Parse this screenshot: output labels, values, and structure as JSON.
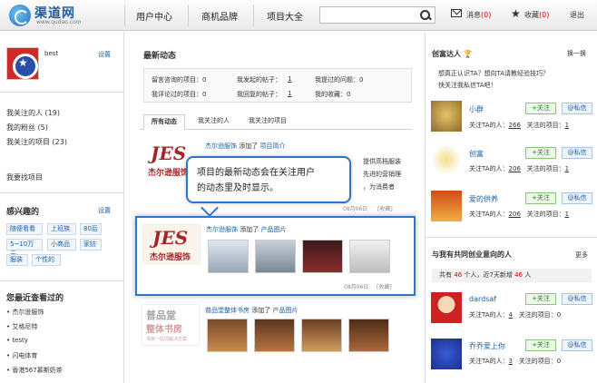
{
  "header": {
    "logo_text": "渠道网",
    "logo_sub": "www.qudao.com",
    "nav": [
      "用户中心",
      "商机品牌",
      "项目大全"
    ],
    "search_placeholder": "",
    "messages_label": "消息",
    "messages_count": "(0)",
    "favorites_label": "收藏",
    "favorites_count": "(0)",
    "logout": "退出"
  },
  "left": {
    "username": "best",
    "settings": "设置",
    "stats": [
      "我关注的人 (19)",
      "我的粉丝 (5)",
      "我关注的项目 (23)"
    ],
    "find_project": "我要找项目",
    "interest_title": "感兴趣的",
    "interest_settings": "设置",
    "interest_tags": [
      "随便看看",
      "上班族",
      "80后",
      "5~10万元",
      "小商品",
      "家纺",
      "服装",
      "个性的"
    ],
    "recent_title": "您最近查看过的",
    "recent_items": [
      "• 杰尔逊服饰",
      "• 艾格尼特",
      "• testy",
      "• 闪电体育",
      "• 香港567慕斯奶茶"
    ]
  },
  "main": {
    "title": "最新动态",
    "stats_box": {
      "row1": [
        "留言咨询的项目：0",
        "我发起的帖子：",
        "1",
        "我提过的问题：0"
      ],
      "row2": [
        "我评论过的项目：0",
        "我回复的帖子：",
        "1",
        "我的收藏：0"
      ]
    },
    "tabs": [
      "所有动态",
      "我关注的人",
      "我关注的项目"
    ],
    "feed": [
      {
        "company": "杰尔逊服饰",
        "action": "添加了",
        "target": "项目简介",
        "snippet1": "提供高档服装",
        "snippet2": "先进的营销理",
        "snippet3": "，为消费者"
      },
      {
        "company": "杰尔逊服饰",
        "action": "添加了",
        "target": "产品图片",
        "date": "08月06日",
        "fav": "[收藏]"
      },
      {
        "company": "普品堂整体书房",
        "action": "添加了",
        "target": "产品图片",
        "date": "08月06日",
        "fav": "[收藏]"
      }
    ],
    "first_date": "08月06日",
    "first_fav": "[收藏]",
    "brand_logo_text": "杰尔逊服饰",
    "brand_logo_mark": "JES",
    "shop_logo_text": "普品堂",
    "shop_logo_sub": "整体书房",
    "shop_logo_tag": "书房一站式解决方案",
    "tooltip_line1": "项目的最新动态会在关注用户",
    "tooltip_line2": "的动态里及时显示。"
  },
  "right": {
    "section1_title": "创富达人",
    "section1_more": "换一换",
    "desc1": "想真正认识TA？想向TA请教经验技巧？",
    "desc2": "快关注我私信TA吧！",
    "people": [
      {
        "name": "小群",
        "fans_label": "关注TA的人：",
        "fans": "266",
        "proj_label": "关注的项目：",
        "proj": "1"
      },
      {
        "name": "创富",
        "fans_label": "关注TA的人：",
        "fans": "206",
        "proj_label": "关注的项目：",
        "proj": "1"
      },
      {
        "name": "爱的供养",
        "fans_label": "关注TA的人：",
        "fans": "206",
        "proj_label": "关注的项目：",
        "proj": "1"
      }
    ],
    "follow": "+关注",
    "message": "@私信",
    "section2_title": "与我有共同创业意向的人",
    "section2_more": "更多",
    "common_bar_prefix": "共有",
    "common_count": "46",
    "common_bar_mid": "个人，近7天新增",
    "common_new": "46",
    "common_bar_suffix": "人",
    "people2": [
      {
        "name": "dardsaf",
        "fans_label": "关注TA的人：",
        "fans": "4",
        "proj_label": "关注的项目：",
        "proj": "0"
      },
      {
        "name": "乔乔爱上你",
        "fans_label": "关注TA的人：",
        "fans": "3",
        "proj_label": "关注的项目：",
        "proj": "0"
      }
    ]
  },
  "colors": {
    "brand_blue": "#1c5fa8",
    "highlight_border": "#2b76c6",
    "brand_red": "#a4262b",
    "follow_green": "#2c7a1e"
  }
}
